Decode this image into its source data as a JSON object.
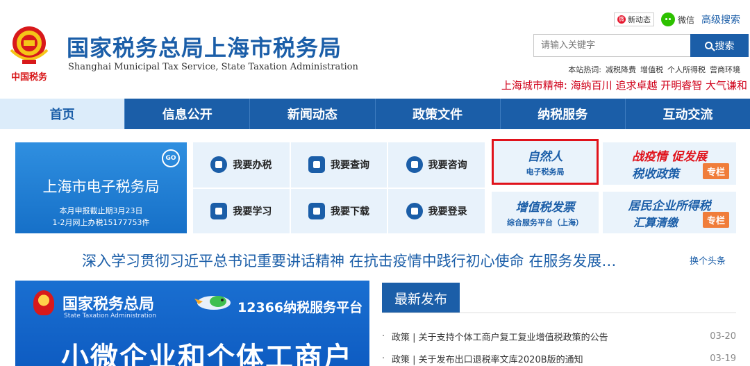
{
  "header": {
    "emblem_text": "中国税务",
    "title_cn": "国家税务总局上海市税务局",
    "title_en": "Shanghai Municipal Tax Service, State Taxation Administration",
    "weibo_label": "新动态",
    "wechat_label": "微信",
    "advanced_search": "高级搜索",
    "search_placeholder": "请输入关键字",
    "search_button": "搜索",
    "hot_label": "本站热词:",
    "hot_words": [
      "减税降费",
      "增值税",
      "个人所得税",
      "营商环境"
    ],
    "city_spirit": "上海城市精神:  海纳百川 追求卓越 开明睿智 大气谦和"
  },
  "nav": {
    "items": [
      "首页",
      "信息公开",
      "新闻动态",
      "政策文件",
      "纳税服务",
      "互动交流"
    ]
  },
  "etax": {
    "title": "上海市电子税务局",
    "deadline": "本月申报截止期3月23日",
    "count": "1-2月网上办税15177753件",
    "go_icon": "GO"
  },
  "services": [
    {
      "label": "我要办税",
      "icon": "tax-icon"
    },
    {
      "label": "我要查询",
      "icon": "query-icon"
    },
    {
      "label": "我要咨询",
      "icon": "consult-icon"
    },
    {
      "label": "我要学习",
      "icon": "study-icon"
    },
    {
      "label": "我要下载",
      "icon": "download-icon"
    },
    {
      "label": "我要登录",
      "icon": "login-icon"
    }
  ],
  "promos": {
    "natural_person_l1": "自然人",
    "natural_person_l2": "电子税务局",
    "vat_l1": "增值税发票",
    "vat_l2": "综合服务平台（上海）",
    "epidemic_l1": "战疫情 促发展",
    "epidemic_l2": "税收政策",
    "epidemic_tag": "专栏",
    "income_l1": "居民企业所得税",
    "income_l2": "汇算清缴",
    "income_tag": "专栏"
  },
  "headline": {
    "text": "深入学习贯彻习近平总书记重要讲话精神 在抗击疫情中践行初心使命 在服务发展…",
    "switch": "换个头条"
  },
  "banner": {
    "org_cn": "国家税务总局",
    "org_en": "State Taxation Administration",
    "hotline": "12366纳税服务平台",
    "slogan": "小微企业和个体工商户"
  },
  "latest": {
    "title": "最新发布",
    "items": [
      {
        "text": "政策 | 关于支持个体工商户复工复业增值税政策的公告",
        "date": "03-20"
      },
      {
        "text": "政策 | 关于发布出口退税率文库2020B版的通知",
        "date": "03-19"
      }
    ]
  },
  "colors": {
    "brand_blue": "#1b5ea8",
    "accent_red": "#e0121b",
    "tag_orange": "#f07d3a"
  }
}
